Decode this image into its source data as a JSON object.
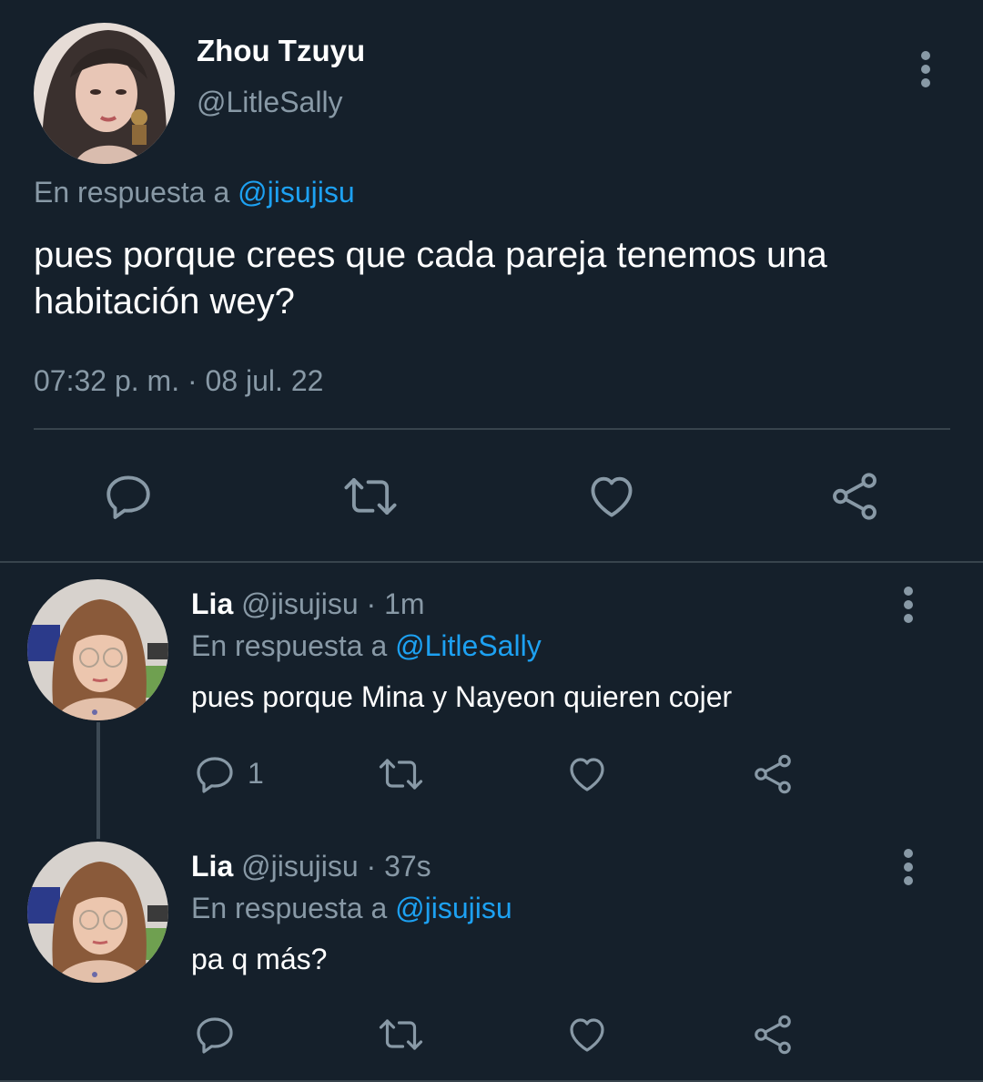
{
  "main_tweet": {
    "author_name": "Zhou Tzuyu",
    "handle": "@LitleSally",
    "reply_prefix": "En respuesta a",
    "reply_to": "@jisujisu",
    "text_line1": "pues porque crees que cada pareja tenemos una",
    "text_line2": "habitación wey?",
    "timestamp": "07:32 p. m. · 08 jul. 22"
  },
  "replies": [
    {
      "author_name": "Lia",
      "handle": "@jisujisu",
      "time": "· 1m",
      "reply_prefix": "En respuesta a",
      "reply_to": "@LitleSally",
      "text": "pues porque Mina y Nayeon quieren cojer",
      "reply_count": "1"
    },
    {
      "author_name": "Lia",
      "handle": "@jisujisu",
      "time": "· 37s",
      "reply_prefix": "En respuesta a",
      "reply_to": "@jisujisu",
      "text": "pa q más?"
    }
  ],
  "icons": {
    "reply": "reply-icon",
    "retweet": "retweet-icon",
    "like": "like-icon",
    "share": "share-icon",
    "more": "more-options-icon"
  },
  "colors": {
    "background": "#15202b",
    "text": "#ffffff",
    "muted": "#8899a6",
    "link": "#1da1f2",
    "divider": "#38444d"
  }
}
